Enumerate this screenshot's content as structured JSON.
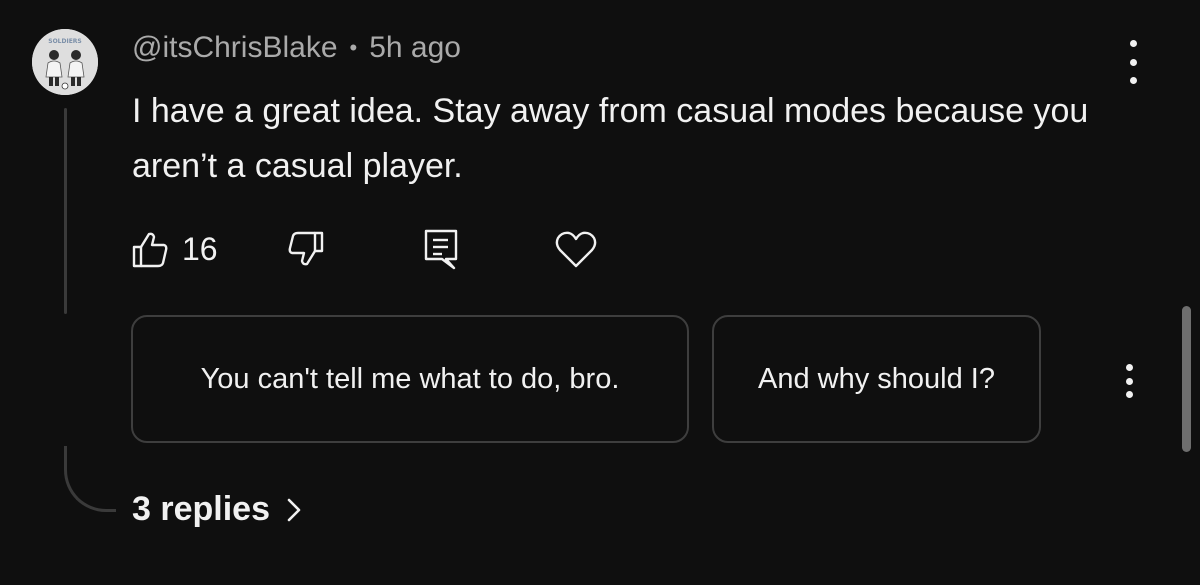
{
  "comment": {
    "author": "@itsChrisBlake",
    "separator": "•",
    "time": "5h ago",
    "text": "I have a great idea. Stay away from casual modes because you aren’t a casual player."
  },
  "avatar_text": "SOLDIERS",
  "actions": {
    "like_count": "16",
    "icons": [
      "thumbs-up-icon",
      "thumbs-down-icon",
      "reply-icon",
      "heart-icon"
    ]
  },
  "suggested_replies": [
    "You can't tell me what to do, bro.",
    "And why should I?"
  ],
  "replies_link": {
    "label": "3 replies"
  },
  "colors": {
    "background": "#0f0f0f",
    "text": "#f1f1f1",
    "secondary_text": "#aaaaaa",
    "border": "#3e3e3e"
  }
}
